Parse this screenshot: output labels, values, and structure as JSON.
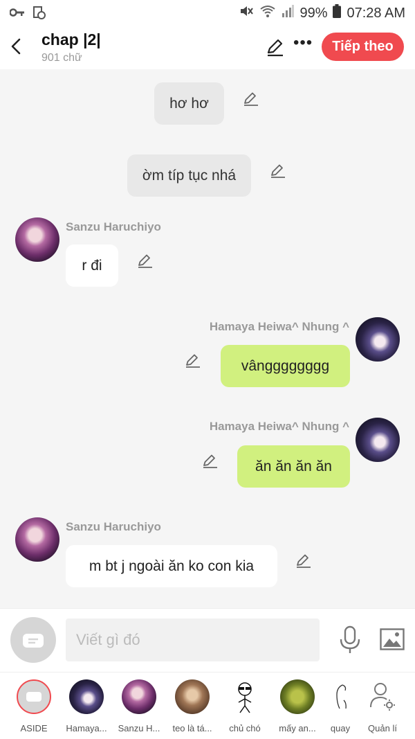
{
  "status_bar": {
    "battery": "99%",
    "time": "07:28 AM"
  },
  "header": {
    "title": "chap |2|",
    "word_count": "901 chữ",
    "next_label": "Tiếp theo"
  },
  "messages": [
    {
      "type": "narration",
      "text": "hơ hơ"
    },
    {
      "type": "narration",
      "text": "ờm típ tục nhá"
    },
    {
      "type": "left",
      "name": "Sanzu Haruchiyo",
      "text": "r đi"
    },
    {
      "type": "right",
      "name": "Hamaya Heiwa^ Nhung ^",
      "text": "vângggggggg"
    },
    {
      "type": "right",
      "name": "Hamaya Heiwa^ Nhung ^",
      "text": "ăn ăn ăn ăn"
    },
    {
      "type": "left",
      "name": "Sanzu Haruchiyo",
      "text": "m bt j ngoài ăn ko con kia"
    }
  ],
  "input": {
    "placeholder": "Viết gì đó"
  },
  "characters": [
    {
      "label": "ASIDE",
      "icon": "aside-icon"
    },
    {
      "label": "Hamaya...",
      "icon": "hamaya-avatar"
    },
    {
      "label": "Sanzu H...",
      "icon": "sanzu-avatar"
    },
    {
      "label": "teo là tá...",
      "icon": "teo-avatar"
    },
    {
      "label": "chủ chó",
      "icon": "stickman-sunglasses-icon"
    },
    {
      "label": "mấy an...",
      "icon": "shrek-avatar"
    },
    {
      "label": "quay",
      "icon": "sketch-figure-icon"
    },
    {
      "label": "Quản lí",
      "icon": "manage-user-icon"
    }
  ],
  "colors": {
    "accent": "#f04a4f",
    "right_bubble": "#d1f07f",
    "left_bubble": "#ffffff",
    "narration_bubble": "#e8e8e8"
  }
}
